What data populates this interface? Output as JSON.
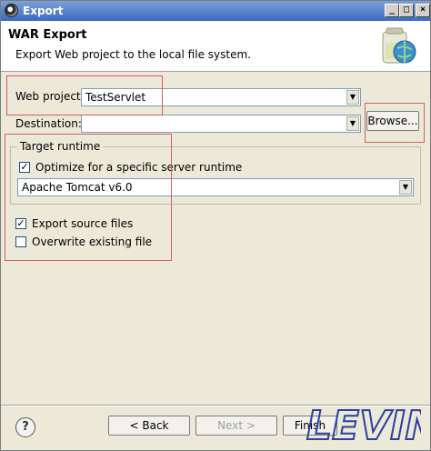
{
  "window": {
    "title": "Export",
    "minimize": "_",
    "maximize": "□",
    "close": "×"
  },
  "header": {
    "title": "WAR Export",
    "description": "Export Web project to the local file system.",
    "icon": "war-export-icon"
  },
  "form": {
    "web_project_label": "Web project:",
    "web_project_value": "TestServlet",
    "destination_label": "Destination:",
    "destination_value": "",
    "browse_label": "Browse..."
  },
  "target_runtime": {
    "title": "Target runtime",
    "optimize_label": "Optimize for a specific server runtime",
    "optimize_checked": true,
    "runtime_value": "Apache Tomcat v6.0"
  },
  "options": {
    "export_source_label": "Export source files",
    "export_source_checked": true,
    "overwrite_label": "Overwrite existing file",
    "overwrite_checked": false
  },
  "footer": {
    "help": "?",
    "back_label": "< Back",
    "next_label": "Next >",
    "finish_label": "Finish"
  },
  "watermark": "LEVIN",
  "colors": {
    "highlight": "#d06060",
    "watermark": "#2a3fa0"
  }
}
